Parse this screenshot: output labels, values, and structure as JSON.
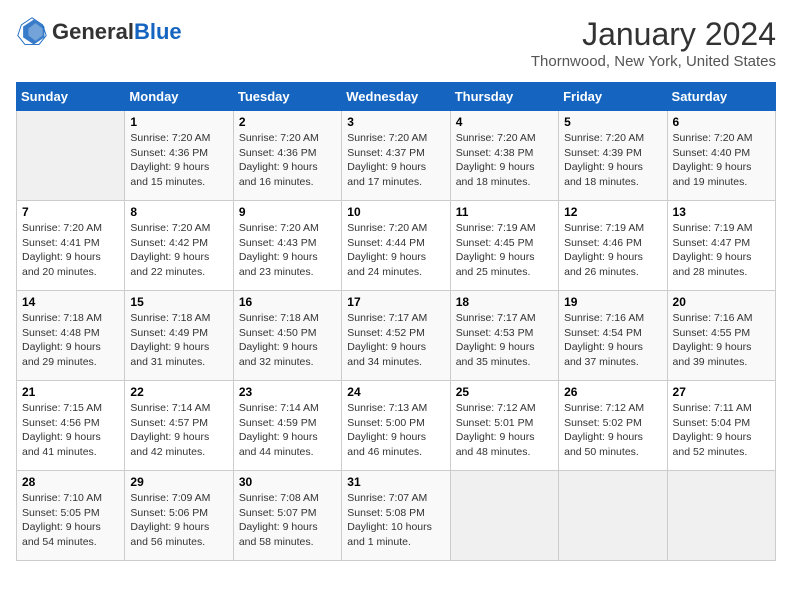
{
  "header": {
    "logo_general": "General",
    "logo_blue": "Blue",
    "month_title": "January 2024",
    "location": "Thornwood, New York, United States"
  },
  "days_of_week": [
    "Sunday",
    "Monday",
    "Tuesday",
    "Wednesday",
    "Thursday",
    "Friday",
    "Saturday"
  ],
  "weeks": [
    [
      {
        "num": "",
        "sunrise": "",
        "sunset": "",
        "daylight": ""
      },
      {
        "num": "1",
        "sunrise": "Sunrise: 7:20 AM",
        "sunset": "Sunset: 4:36 PM",
        "daylight": "Daylight: 9 hours and 15 minutes."
      },
      {
        "num": "2",
        "sunrise": "Sunrise: 7:20 AM",
        "sunset": "Sunset: 4:36 PM",
        "daylight": "Daylight: 9 hours and 16 minutes."
      },
      {
        "num": "3",
        "sunrise": "Sunrise: 7:20 AM",
        "sunset": "Sunset: 4:37 PM",
        "daylight": "Daylight: 9 hours and 17 minutes."
      },
      {
        "num": "4",
        "sunrise": "Sunrise: 7:20 AM",
        "sunset": "Sunset: 4:38 PM",
        "daylight": "Daylight: 9 hours and 18 minutes."
      },
      {
        "num": "5",
        "sunrise": "Sunrise: 7:20 AM",
        "sunset": "Sunset: 4:39 PM",
        "daylight": "Daylight: 9 hours and 18 minutes."
      },
      {
        "num": "6",
        "sunrise": "Sunrise: 7:20 AM",
        "sunset": "Sunset: 4:40 PM",
        "daylight": "Daylight: 9 hours and 19 minutes."
      }
    ],
    [
      {
        "num": "7",
        "sunrise": "Sunrise: 7:20 AM",
        "sunset": "Sunset: 4:41 PM",
        "daylight": "Daylight: 9 hours and 20 minutes."
      },
      {
        "num": "8",
        "sunrise": "Sunrise: 7:20 AM",
        "sunset": "Sunset: 4:42 PM",
        "daylight": "Daylight: 9 hours and 22 minutes."
      },
      {
        "num": "9",
        "sunrise": "Sunrise: 7:20 AM",
        "sunset": "Sunset: 4:43 PM",
        "daylight": "Daylight: 9 hours and 23 minutes."
      },
      {
        "num": "10",
        "sunrise": "Sunrise: 7:20 AM",
        "sunset": "Sunset: 4:44 PM",
        "daylight": "Daylight: 9 hours and 24 minutes."
      },
      {
        "num": "11",
        "sunrise": "Sunrise: 7:19 AM",
        "sunset": "Sunset: 4:45 PM",
        "daylight": "Daylight: 9 hours and 25 minutes."
      },
      {
        "num": "12",
        "sunrise": "Sunrise: 7:19 AM",
        "sunset": "Sunset: 4:46 PM",
        "daylight": "Daylight: 9 hours and 26 minutes."
      },
      {
        "num": "13",
        "sunrise": "Sunrise: 7:19 AM",
        "sunset": "Sunset: 4:47 PM",
        "daylight": "Daylight: 9 hours and 28 minutes."
      }
    ],
    [
      {
        "num": "14",
        "sunrise": "Sunrise: 7:18 AM",
        "sunset": "Sunset: 4:48 PM",
        "daylight": "Daylight: 9 hours and 29 minutes."
      },
      {
        "num": "15",
        "sunrise": "Sunrise: 7:18 AM",
        "sunset": "Sunset: 4:49 PM",
        "daylight": "Daylight: 9 hours and 31 minutes."
      },
      {
        "num": "16",
        "sunrise": "Sunrise: 7:18 AM",
        "sunset": "Sunset: 4:50 PM",
        "daylight": "Daylight: 9 hours and 32 minutes."
      },
      {
        "num": "17",
        "sunrise": "Sunrise: 7:17 AM",
        "sunset": "Sunset: 4:52 PM",
        "daylight": "Daylight: 9 hours and 34 minutes."
      },
      {
        "num": "18",
        "sunrise": "Sunrise: 7:17 AM",
        "sunset": "Sunset: 4:53 PM",
        "daylight": "Daylight: 9 hours and 35 minutes."
      },
      {
        "num": "19",
        "sunrise": "Sunrise: 7:16 AM",
        "sunset": "Sunset: 4:54 PM",
        "daylight": "Daylight: 9 hours and 37 minutes."
      },
      {
        "num": "20",
        "sunrise": "Sunrise: 7:16 AM",
        "sunset": "Sunset: 4:55 PM",
        "daylight": "Daylight: 9 hours and 39 minutes."
      }
    ],
    [
      {
        "num": "21",
        "sunrise": "Sunrise: 7:15 AM",
        "sunset": "Sunset: 4:56 PM",
        "daylight": "Daylight: 9 hours and 41 minutes."
      },
      {
        "num": "22",
        "sunrise": "Sunrise: 7:14 AM",
        "sunset": "Sunset: 4:57 PM",
        "daylight": "Daylight: 9 hours and 42 minutes."
      },
      {
        "num": "23",
        "sunrise": "Sunrise: 7:14 AM",
        "sunset": "Sunset: 4:59 PM",
        "daylight": "Daylight: 9 hours and 44 minutes."
      },
      {
        "num": "24",
        "sunrise": "Sunrise: 7:13 AM",
        "sunset": "Sunset: 5:00 PM",
        "daylight": "Daylight: 9 hours and 46 minutes."
      },
      {
        "num": "25",
        "sunrise": "Sunrise: 7:12 AM",
        "sunset": "Sunset: 5:01 PM",
        "daylight": "Daylight: 9 hours and 48 minutes."
      },
      {
        "num": "26",
        "sunrise": "Sunrise: 7:12 AM",
        "sunset": "Sunset: 5:02 PM",
        "daylight": "Daylight: 9 hours and 50 minutes."
      },
      {
        "num": "27",
        "sunrise": "Sunrise: 7:11 AM",
        "sunset": "Sunset: 5:04 PM",
        "daylight": "Daylight: 9 hours and 52 minutes."
      }
    ],
    [
      {
        "num": "28",
        "sunrise": "Sunrise: 7:10 AM",
        "sunset": "Sunset: 5:05 PM",
        "daylight": "Daylight: 9 hours and 54 minutes."
      },
      {
        "num": "29",
        "sunrise": "Sunrise: 7:09 AM",
        "sunset": "Sunset: 5:06 PM",
        "daylight": "Daylight: 9 hours and 56 minutes."
      },
      {
        "num": "30",
        "sunrise": "Sunrise: 7:08 AM",
        "sunset": "Sunset: 5:07 PM",
        "daylight": "Daylight: 9 hours and 58 minutes."
      },
      {
        "num": "31",
        "sunrise": "Sunrise: 7:07 AM",
        "sunset": "Sunset: 5:08 PM",
        "daylight": "Daylight: 10 hours and 1 minute."
      },
      {
        "num": "",
        "sunrise": "",
        "sunset": "",
        "daylight": ""
      },
      {
        "num": "",
        "sunrise": "",
        "sunset": "",
        "daylight": ""
      },
      {
        "num": "",
        "sunrise": "",
        "sunset": "",
        "daylight": ""
      }
    ]
  ]
}
